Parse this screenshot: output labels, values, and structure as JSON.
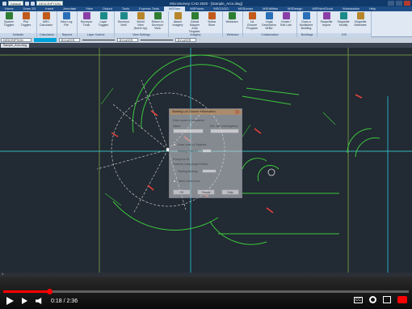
{
  "title": "MicroSurvey CAD 2020 - [Sample_Arcs.dwg]",
  "quick_access": {
    "workspace": "Default",
    "layer_field": "DESCRIPTION"
  },
  "tabs": [
    "Home",
    "Draw 2D",
    "Insert",
    "Annotate",
    "View",
    "Output",
    "Tools",
    "Express Tools",
    "MSSurv",
    "MSPoints",
    "MSCOGO",
    "MSSurvey",
    "MSUtilities",
    "MSDesign",
    "MSPointCloud",
    "Workstation",
    "Help"
  ],
  "active_tab": "MSSurv",
  "ribbon_groups": [
    {
      "label": "Defaults",
      "buttons": [
        "System Toggles",
        "Plot Toggles"
      ]
    },
    {
      "label": "Calculators",
      "buttons": [
        "MRC Calculator"
      ]
    },
    {
      "label": "Reports",
      "buttons": [
        "View Log File"
      ]
    },
    {
      "label": "Layer Control",
      "buttons": [
        "Surveyor Tools",
        "Layer Toggles"
      ]
    },
    {
      "label": "View Settings",
      "buttons": [
        "Surveyor View",
        "World View (North Up)",
        "Return to Surveyor View"
      ]
    },
    {
      "label": "Imagery",
      "buttons": [
        "Attach Imagery",
        "Global Mapper Auto Register",
        "Yellow Store"
      ]
    },
    {
      "label": "Webinars",
      "buttons": [
        "Webinars"
      ]
    },
    {
      "label": "Collaboration",
      "buttons": [
        "1st Closure Program",
        "Legal Description Writer",
        "Create / Edit Lots"
      ]
    },
    {
      "label": "Buildings",
      "buttons": [
        "Draw a Multisided Building"
      ]
    },
    {
      "label": "GIS",
      "buttons": [
        "Shapefile Import",
        "Shapefile Modify",
        "Shapefile Attributes"
      ]
    }
  ],
  "propbar": {
    "layer": "DESCRIPTION",
    "color": "BYLAYER",
    "linetype": "BYLAYER",
    "lineweight": "BYLAYER"
  },
  "doc_tab": "Sample_Arcs.dwg",
  "dialog": {
    "title": "Starting Lot Closure Information",
    "enter_name_label": "Enter name of lot/traverse",
    "name_label": "Name:",
    "lots_label": "Enc. lots (existing/lots):",
    "option1": "Draw Lines or Polylines",
    "option2": "Starting Point ID",
    "option3": "Prompt for ID",
    "option4": "Traverse using Angle Entries",
    "option5": "Starting Bearing:",
    "option6": "Detect Lines/ Arcs",
    "ok": "OK",
    "cancel": "Cancel",
    "help": "Help"
  },
  "cmdline": "1",
  "video": {
    "time": "0:18 / 2:36",
    "progress": 0.115
  },
  "colors": {
    "ribbon_bg": "#dfe8f3",
    "canvas_bg": "#222a33",
    "green": "#3cc83c",
    "cyan": "#27c5e0",
    "red": "#e3403a"
  }
}
